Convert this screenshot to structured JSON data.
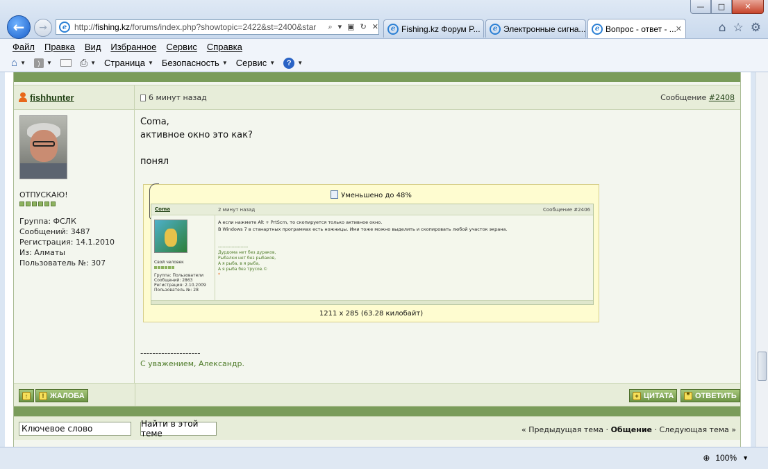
{
  "window": {
    "min": "—",
    "max": "□",
    "close": "✕"
  },
  "address": {
    "url_prefix": "http://",
    "url_domain": "fishing.kz",
    "url_rest": "/forums/index.php?showtopic=2422&st=2400&star"
  },
  "tabs": [
    {
      "label": "Fishing.kz Форум P..."
    },
    {
      "label": "Электронные сигна..."
    },
    {
      "label": "Вопрос - ответ - ...",
      "active": true
    }
  ],
  "menu": [
    "Файл",
    "Правка",
    "Вид",
    "Избранное",
    "Сервис",
    "Справка"
  ],
  "cmdbar": {
    "page": "Страница",
    "security": "Безопасность",
    "tools": "Сервис"
  },
  "post": {
    "username": "fishhunter",
    "time": "6 минут назад",
    "num_label": "Сообщение ",
    "num": "#2408",
    "status": "ОТПУСКАЮ!",
    "pips": 6,
    "group": "Группа: ФСЛК",
    "messages": "Сообщений: 3487",
    "registered": "Регистрация: 14.1.2010",
    "from": "Из: Алматы",
    "user_no": "Пользователь №: 307",
    "lines": [
      "Coma,",
      "активное окно это как?",
      "",
      "понял"
    ],
    "sig_line": "--------------------",
    "sig_text": "С уважением, Александр."
  },
  "attachment": {
    "reduced": "Уменьшено до 48%",
    "info": "1211 x 285 (63.28 килобайт)",
    "thumb": {
      "user": "Coma",
      "time": "2 минут назад",
      "num": "Сообщение #2406",
      "status": "Свой человек",
      "info": [
        "Группа: Пользователи",
        "Сообщений: 2863",
        "Регистрация: 2.10.2009",
        "Пользователь №: 28"
      ],
      "text": [
        "А если нажмете Alt + PrtScrn, то скопируется только активное окно.",
        "В Windows 7 в станартных программах есть ножницы. Ими тоже можно выделить и скопировать любой участок экрана."
      ],
      "sig": [
        "--------------------",
        "Дурдома нет без дураков,",
        "Рыбалки нет без рыбаков,",
        "А я рыба, в я рыба,",
        "А я рыба без трусов.©",
        "*"
      ]
    }
  },
  "buttons": {
    "up": "↑",
    "complaint": "ЖАЛОБА",
    "quote": "ЦИТАТА",
    "reply": "ОТВЕТИТЬ"
  },
  "bottom": {
    "keyword": "Ключевое слово",
    "find": "Найти в этой теме",
    "prev": "« Предыдущая тема",
    "sep1": " · ",
    "current": "Общение",
    "sep2": " · ",
    "next": "Следующая тема »"
  },
  "status": {
    "zoom": "100%"
  }
}
